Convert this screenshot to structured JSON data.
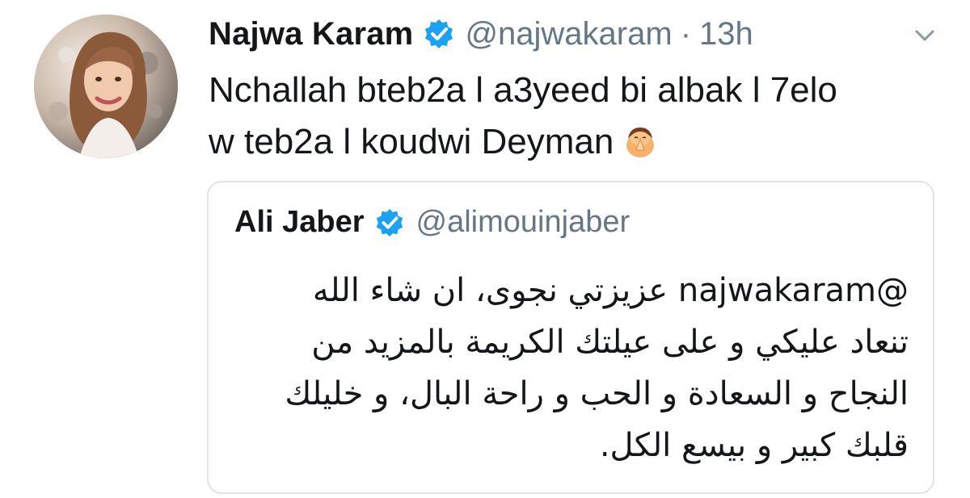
{
  "author": {
    "name": "Najwa Karam",
    "handle": "@najwakaram",
    "separator": "·",
    "time": "13h"
  },
  "tweet": {
    "lines": [
      "Nchallah bteb2a l a3yeed bi albak l 7elo",
      "w teb2a l koudwi Deyman"
    ],
    "emoji": "person-praying-emoji"
  },
  "quoted": {
    "name": "Ali Jaber",
    "handle": "@alimouinjaber",
    "lines": [
      "@najwakaram عزيزتي نجوى، ان شاء الله",
      "تنعاد عليكي و على عيلتك الكريمة بالمزيد من",
      "النجاح و السعادة و الحب و راحة البال، و خليلك",
      "قلبك كبير و بيسع الكل."
    ]
  },
  "colors": {
    "verified": "#1da1f2",
    "muted": "#657786",
    "border": "#dfe4e8"
  }
}
